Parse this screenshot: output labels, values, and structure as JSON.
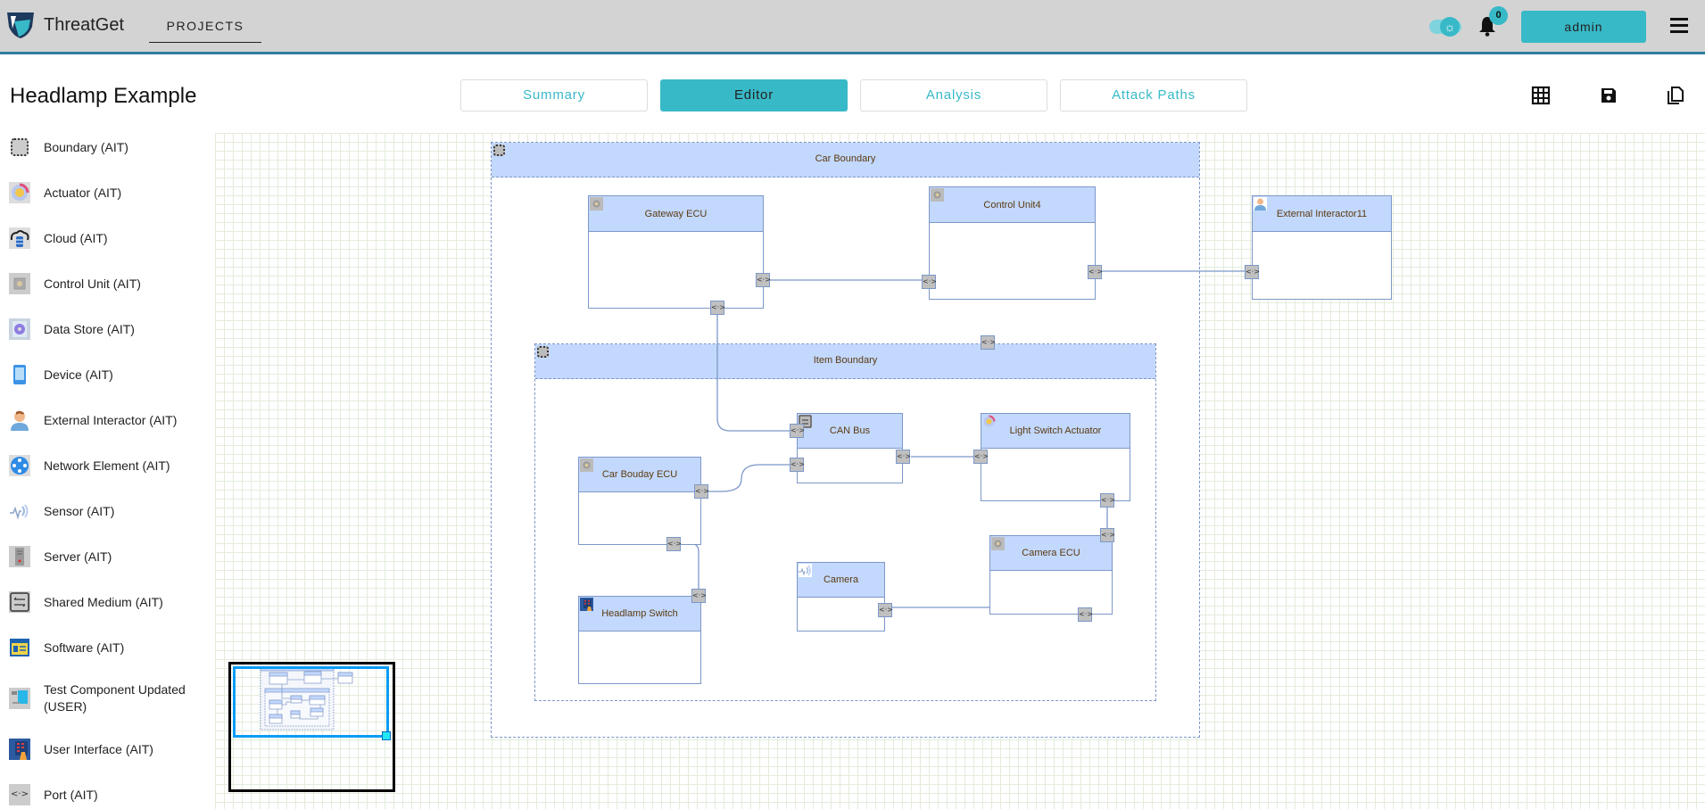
{
  "app": {
    "brand": "ThreatGet",
    "nav_projects": "PROJECTS",
    "notifications_count": "0",
    "user_button": "admin",
    "accent_color": "#38b9c7"
  },
  "page": {
    "title": "Headlamp Example",
    "tabs": [
      {
        "label": "Summary",
        "active": false
      },
      {
        "label": "Editor",
        "active": true
      },
      {
        "label": "Analysis",
        "active": false
      },
      {
        "label": "Attack Paths",
        "active": false
      }
    ],
    "toolbar": [
      "grid-icon",
      "save-icon",
      "copy-icon"
    ]
  },
  "sidebar": {
    "items": [
      {
        "label": "Boundary (AIT)",
        "icon": "boundary-icon"
      },
      {
        "label": "Actuator (AIT)",
        "icon": "actuator-icon"
      },
      {
        "label": "Cloud (AIT)",
        "icon": "cloud-icon"
      },
      {
        "label": "Control Unit (AIT)",
        "icon": "control-unit-icon"
      },
      {
        "label": "Data Store (AIT)",
        "icon": "data-store-icon"
      },
      {
        "label": "Device (AIT)",
        "icon": "device-icon"
      },
      {
        "label": "External Interactor (AIT)",
        "icon": "external-interactor-icon"
      },
      {
        "label": "Network Element (AIT)",
        "icon": "network-element-icon"
      },
      {
        "label": "Sensor (AIT)",
        "icon": "sensor-icon"
      },
      {
        "label": "Server (AIT)",
        "icon": "server-icon"
      },
      {
        "label": "Shared Medium (AIT)",
        "icon": "shared-medium-icon"
      },
      {
        "label": "Software (AIT)",
        "icon": "software-icon"
      },
      {
        "label": "Test Component Updated (USER)",
        "icon": "test-component-icon"
      },
      {
        "label": "User Interface (AIT)",
        "icon": "user-interface-icon"
      },
      {
        "label": "Port (AIT)",
        "icon": "port-icon"
      }
    ]
  },
  "diagram": {
    "boundaries": [
      {
        "id": "car-boundary",
        "label": "Car Boundary"
      },
      {
        "id": "item-boundary",
        "label": "Item Boundary"
      }
    ],
    "nodes": [
      {
        "id": "gateway-ecu",
        "label": "Gateway ECU",
        "type": "control-unit",
        "boundary": "Car Boundary"
      },
      {
        "id": "control-unit4",
        "label": "Control Unit4",
        "type": "control-unit",
        "boundary": "Car Boundary"
      },
      {
        "id": "external-interactor11",
        "label": "External Interactor11",
        "type": "external-interactor",
        "boundary": ""
      },
      {
        "id": "can-bus",
        "label": "CAN Bus",
        "type": "shared-medium",
        "boundary": "Item Boundary"
      },
      {
        "id": "light-switch-actuator",
        "label": "Light Switch Actuator",
        "type": "actuator",
        "boundary": "Item Boundary"
      },
      {
        "id": "car-bouday-ecu",
        "label": "Car Bouday ECU",
        "type": "control-unit",
        "boundary": "Item Boundary"
      },
      {
        "id": "camera-ecu",
        "label": "Camera ECU",
        "type": "control-unit",
        "boundary": "Item Boundary"
      },
      {
        "id": "camera",
        "label": "Camera",
        "type": "sensor",
        "boundary": "Item Boundary"
      },
      {
        "id": "headlamp-switch",
        "label": "Headlamp Switch",
        "type": "user-interface",
        "boundary": "Item Boundary"
      }
    ],
    "connections": [
      {
        "from": "Gateway ECU",
        "to": "Control Unit4"
      },
      {
        "from": "Control Unit4",
        "to": "External Interactor11"
      },
      {
        "from": "Gateway ECU",
        "to": "CAN Bus"
      },
      {
        "from": "CAN Bus",
        "to": "Light Switch Actuator"
      },
      {
        "from": "Car Bouday ECU",
        "to": "CAN Bus"
      },
      {
        "from": "Car Bouday ECU",
        "to": "Headlamp Switch"
      },
      {
        "from": "Light Switch Actuator",
        "to": "Camera ECU"
      },
      {
        "from": "Camera",
        "to": "Camera ECU"
      }
    ],
    "port_glyph": "<·>"
  }
}
